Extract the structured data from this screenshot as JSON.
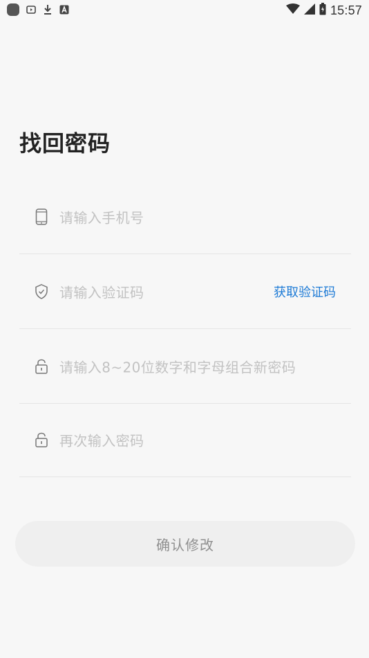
{
  "status_bar": {
    "time": "15:57",
    "left_icons": [
      "app-icon",
      "play-icon",
      "download-icon",
      "a-badge-icon"
    ],
    "right_icons": [
      "wifi-icon",
      "signal-icon",
      "battery-charging-icon"
    ]
  },
  "page": {
    "title": "找回密码"
  },
  "form": {
    "phone": {
      "placeholder": "请输入手机号",
      "icon": "phone-icon"
    },
    "code": {
      "placeholder": "请输入验证码",
      "icon": "shield-icon",
      "action_label": "获取验证码"
    },
    "new_password": {
      "placeholder": "请输入8~20位数字和字母组合新密码",
      "icon": "lock-icon"
    },
    "confirm_password": {
      "placeholder": "再次输入密码",
      "icon": "lock-icon"
    }
  },
  "submit": {
    "label": "确认修改"
  },
  "colors": {
    "link": "#1e7bd6",
    "button_bg": "#efefef",
    "placeholder": "#c2c2c2"
  }
}
